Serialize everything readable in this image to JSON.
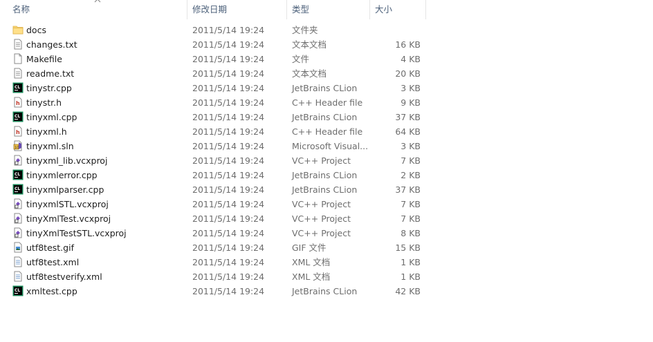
{
  "columns": {
    "name": "名称",
    "date": "修改日期",
    "type": "类型",
    "size": "大小"
  },
  "files": [
    {
      "name": "docs",
      "date": "2011/5/14 19:24",
      "type": "文件夹",
      "size": "",
      "icon": "folder-icon"
    },
    {
      "name": "changes.txt",
      "date": "2011/5/14 19:24",
      "type": "文本文档",
      "size": "16 KB",
      "icon": "text-file-icon"
    },
    {
      "name": "Makefile",
      "date": "2011/5/14 19:24",
      "type": "文件",
      "size": "4 KB",
      "icon": "generic-file-icon"
    },
    {
      "name": "readme.txt",
      "date": "2011/5/14 19:24",
      "type": "文本文档",
      "size": "20 KB",
      "icon": "text-file-icon"
    },
    {
      "name": "tinystr.cpp",
      "date": "2011/5/14 19:24",
      "type": "JetBrains CLion",
      "size": "3 KB",
      "icon": "clion-icon"
    },
    {
      "name": "tinystr.h",
      "date": "2011/5/14 19:24",
      "type": "C++ Header file",
      "size": "9 KB",
      "icon": "header-file-icon"
    },
    {
      "name": "tinyxml.cpp",
      "date": "2011/5/14 19:24",
      "type": "JetBrains CLion",
      "size": "37 KB",
      "icon": "clion-icon"
    },
    {
      "name": "tinyxml.h",
      "date": "2011/5/14 19:24",
      "type": "C++ Header file",
      "size": "64 KB",
      "icon": "header-file-icon"
    },
    {
      "name": "tinyxml.sln",
      "date": "2011/5/14 19:24",
      "type": "Microsoft Visual...",
      "size": "3 KB",
      "icon": "solution-file-icon"
    },
    {
      "name": "tinyxml_lib.vcxproj",
      "date": "2011/5/14 19:24",
      "type": "VC++ Project",
      "size": "7 KB",
      "icon": "vcxproj-icon"
    },
    {
      "name": "tinyxmlerror.cpp",
      "date": "2011/5/14 19:24",
      "type": "JetBrains CLion",
      "size": "2 KB",
      "icon": "clion-icon"
    },
    {
      "name": "tinyxmlparser.cpp",
      "date": "2011/5/14 19:24",
      "type": "JetBrains CLion",
      "size": "37 KB",
      "icon": "clion-icon"
    },
    {
      "name": "tinyxmlSTL.vcxproj",
      "date": "2011/5/14 19:24",
      "type": "VC++ Project",
      "size": "7 KB",
      "icon": "vcxproj-icon"
    },
    {
      "name": "tinyXmlTest.vcxproj",
      "date": "2011/5/14 19:24",
      "type": "VC++ Project",
      "size": "7 KB",
      "icon": "vcxproj-icon"
    },
    {
      "name": "tinyXmlTestSTL.vcxproj",
      "date": "2011/5/14 19:24",
      "type": "VC++ Project",
      "size": "8 KB",
      "icon": "vcxproj-icon"
    },
    {
      "name": "utf8test.gif",
      "date": "2011/5/14 19:24",
      "type": "GIF 文件",
      "size": "15 KB",
      "icon": "image-file-icon"
    },
    {
      "name": "utf8test.xml",
      "date": "2011/5/14 19:24",
      "type": "XML 文档",
      "size": "1 KB",
      "icon": "xml-file-icon"
    },
    {
      "name": "utf8testverify.xml",
      "date": "2011/5/14 19:24",
      "type": "XML 文档",
      "size": "1 KB",
      "icon": "xml-file-icon"
    },
    {
      "name": "xmltest.cpp",
      "date": "2011/5/14 19:24",
      "type": "JetBrains CLion",
      "size": "42 KB",
      "icon": "clion-icon"
    }
  ]
}
